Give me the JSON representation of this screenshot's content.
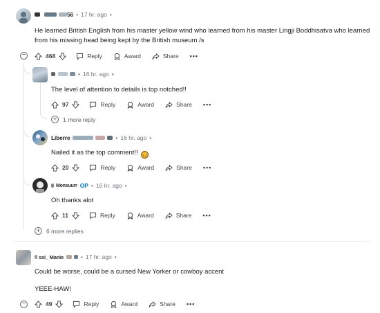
{
  "icons": {
    "upvote": "arrow-up-icon",
    "downvote": "arrow-down-icon",
    "reply": "speech-bubble-icon",
    "award": "award-icon",
    "share": "share-arrow-icon",
    "more": "ellipsis-icon",
    "expand": "plus-circle-icon",
    "collapse": "minus-circle-icon"
  },
  "labels": {
    "reply": "Reply",
    "award": "Award",
    "share": "Share",
    "more": "•••"
  },
  "comments": [
    {
      "username_suffix": "56",
      "time": "17 hr. ago",
      "text": "He learned British English from his master yellow wind who learned from his master Lingji Boddhisatva who learned from his missing head being kept by the British museum /s",
      "votes": "468"
    },
    {
      "username_suffix": "",
      "time": "16 hr. ago",
      "text": "The level of attention to details is top notched!!",
      "votes": "97",
      "more_replies": "1 more reply"
    },
    {
      "username_prefix": "Liberre",
      "time": "16 hr. ago",
      "text": "Nailed it as the top comment!!",
      "votes": "20"
    },
    {
      "username_prefix": "Monsuurr",
      "op_badge": "OP",
      "time": "16 hr. ago",
      "text": "Oh thanks alot",
      "votes": "11"
    },
    {
      "username_prefix": "ssi_ Manie",
      "time": "17 hr. ago",
      "text": "Could be worse, could be a cursed New Yorker or cowboy accent",
      "text2": "YEEE-HAW!",
      "votes": "49"
    }
  ],
  "thread_more_replies": "6 more replies",
  "separator": "•"
}
